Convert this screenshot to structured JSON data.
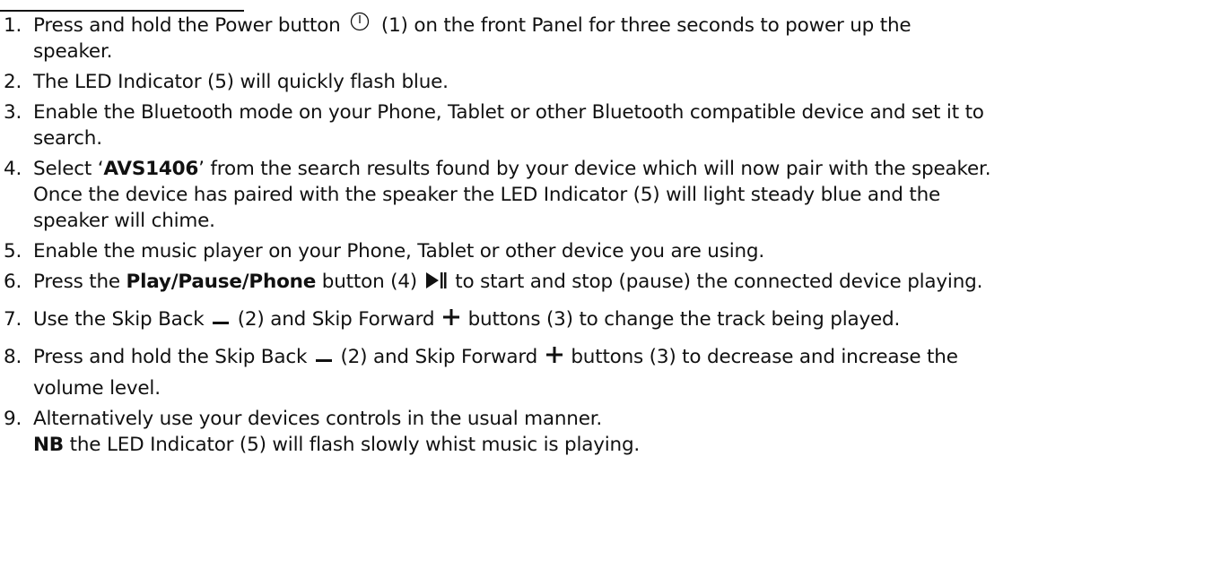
{
  "steps": [
    {
      "num": "1.",
      "a": "Press and hold the Power button",
      "b": "(1) on the front Panel for three seconds to power up the",
      "c": "speaker."
    },
    {
      "num": "2.",
      "a": "The LED Indicator (5) will quickly flash blue."
    },
    {
      "num": "3.",
      "a": "Enable the Bluetooth mode on your Phone, Tablet or other Bluetooth compatible device and set it to",
      "b": "search."
    },
    {
      "num": "4.",
      "a": "Select ‘",
      "bold": "AVS1406",
      "b": "’ from the search results found by your device which will now pair with the speaker.",
      "c": "Once the device has paired with the speaker the LED Indicator (5) will light steady blue and the",
      "d": "speaker will chime."
    },
    {
      "num": "5.",
      "a": "Enable the music player on your Phone, Tablet or other device you are using."
    },
    {
      "num": "6.",
      "a": "Press the",
      "bold": "Play/Pause/Phone",
      "b": "button (4)",
      "c": "to start and stop (pause) the connected device playing."
    },
    {
      "num": "7.",
      "a": "Use the Skip Back",
      "b": "(2) and Skip Forward",
      "c": "buttons (3) to change the track being played."
    },
    {
      "num": "8.",
      "a": "Press and hold the Skip Back",
      "b": "(2) and Skip Forward",
      "c": "buttons (3) to decrease and increase the",
      "d": "volume level."
    },
    {
      "num": "9.",
      "a": "Alternatively use your devices controls in the usual manner.",
      "bold": "NB",
      "b": "the LED Indicator (5) will flash slowly whist music is playing."
    }
  ],
  "icons": {
    "power": "power-icon",
    "play_pause": "play-pause-icon",
    "minus": "minus-icon",
    "plus": "plus-icon"
  }
}
